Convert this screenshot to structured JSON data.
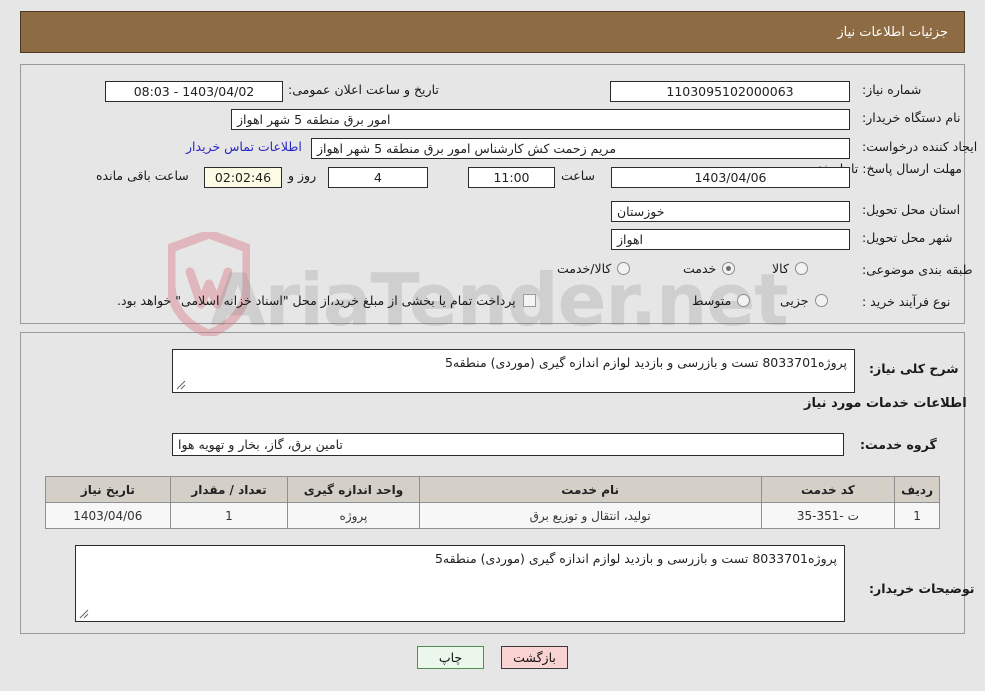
{
  "header": {
    "title": "جزئیات اطلاعات نیاز",
    "bg_color": "#8d6b43"
  },
  "watermark": {
    "text": "AriaTender.net"
  },
  "top_panel": {
    "need_number": {
      "label": "شماره نیاز:",
      "value": "1103095102000063"
    },
    "announce": {
      "label": "تاریخ و ساعت اعلان عمومی:",
      "value": "08:03 - 1403/04/02"
    },
    "buyer_org": {
      "label": "نام دستگاه خریدار:",
      "value": "امور برق منطقه 5 شهر اهواز"
    },
    "creator": {
      "label": "ایجاد کننده درخواست:",
      "value": "مریم زحمت کش کارشناس امور برق منطقه 5 شهر اهواز"
    },
    "buyer_contact_link": "اطلاعات تماس خریدار",
    "deadline": {
      "label": "مهلت ارسال پاسخ: تا تاریخ:",
      "date": "1403/04/06",
      "hour_label": "ساعت",
      "hour": "11:00",
      "days": "4",
      "days_label": "روز و",
      "timer": "02:02:46",
      "timer_label": "ساعت باقی مانده"
    },
    "province": {
      "label": "استان محل تحویل:",
      "value": "خوزستان"
    },
    "city": {
      "label": "شهر محل تحویل:",
      "value": "اهواز"
    },
    "category": {
      "label": "طبقه بندی موضوعی:",
      "options": [
        {
          "label": "کالا",
          "selected": false
        },
        {
          "label": "خدمت",
          "selected": true
        },
        {
          "label": "کالا/خدمت",
          "selected": false
        }
      ]
    },
    "process": {
      "label": "نوع فرآیند خرید :",
      "options": [
        {
          "label": "جزیی",
          "selected": false
        },
        {
          "label": "متوسط",
          "selected": false
        }
      ],
      "checkbox_text": "پرداخت تمام یا بخشی از مبلغ خرید،از محل \"اسناد خزانه اسلامی\" خواهد بود.",
      "checkbox_checked": false
    }
  },
  "mid_panel": {
    "summary": {
      "label": "شرح کلی نیاز:",
      "value": "پروژه8033701 تست و بازرسی و بازدید لوازم اندازه گیری (موردی) منطقه5"
    },
    "services_heading": "اطلاعات خدمات مورد نیاز",
    "service_group": {
      "label": "گروه خدمت:",
      "value": "تامین برق، گاز، بخار و تهویه هوا"
    },
    "table": {
      "columns": [
        "ردیف",
        "کد خدمت",
        "نام خدمت",
        "واحد اندازه گیری",
        "تعداد / مقدار",
        "تاریخ نیاز"
      ],
      "rows": [
        {
          "radif": "1",
          "code": "ت -351-35",
          "name": "تولید، انتقال و توزیع برق",
          "unit": "پروژه",
          "qty": "1",
          "date": "1403/04/06"
        }
      ]
    },
    "buyer_notes": {
      "label": "توضیحات خریدار:",
      "value": "پروژه8033701 تست و بازرسی و بازدید لوازم اندازه گیری (موردی) منطقه5"
    }
  },
  "footer": {
    "back_button": "بازگشت",
    "print_button": "چاپ"
  }
}
